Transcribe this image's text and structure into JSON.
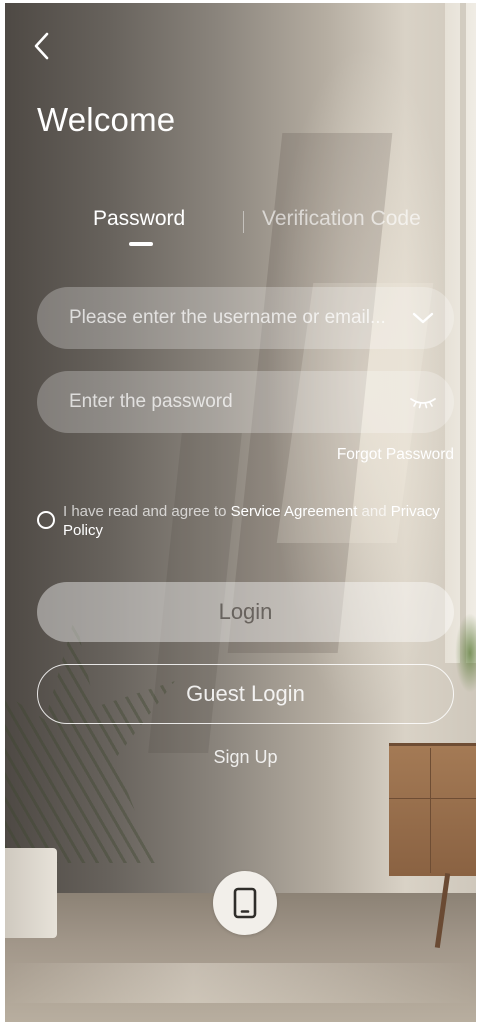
{
  "header": {
    "back_icon": "chevron-left-icon",
    "title": "Welcome"
  },
  "tabs": [
    {
      "label": "Password",
      "active": true
    },
    {
      "label": "Verification Code",
      "active": false
    }
  ],
  "form": {
    "username": {
      "placeholder": "Please enter the username or email...",
      "value": "",
      "icon": "chevron-down-icon"
    },
    "password": {
      "placeholder": "Enter the password",
      "value": "",
      "icon": "eye-closed-icon"
    },
    "forgot_password": "Forgot Password"
  },
  "agreement": {
    "checked": false,
    "prefix": "I have read and agree to ",
    "service_link": "Service Agreement",
    "joiner": " and ",
    "privacy_link": "Privacy Policy"
  },
  "buttons": {
    "login": "Login",
    "guest_login": "Guest Login",
    "sign_up": "Sign Up"
  },
  "footer": {
    "device_icon": "tablet-icon"
  },
  "colors": {
    "text_primary": "#ffffff",
    "field_bg": "rgba(255,255,255,0.26)",
    "device_button_bg": "#f2efea"
  }
}
